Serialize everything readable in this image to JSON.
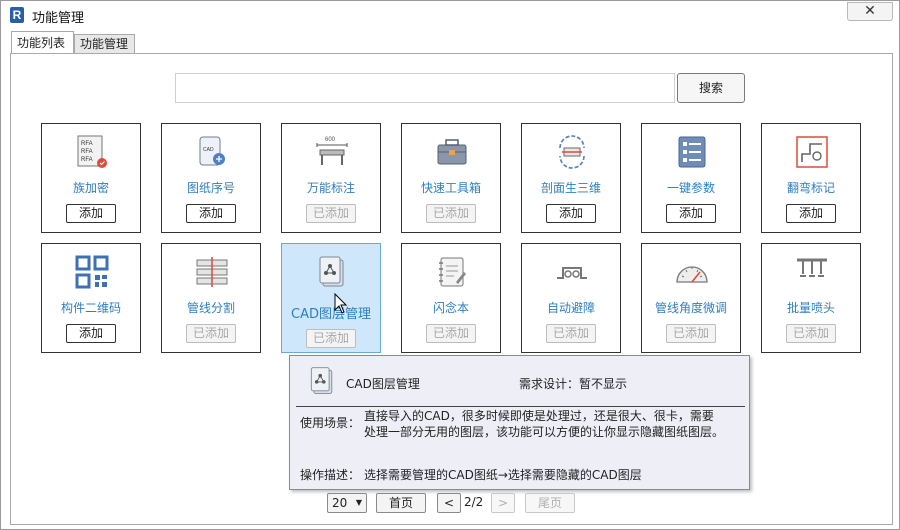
{
  "window": {
    "title": "功能管理",
    "close_symbol": "✕"
  },
  "tabs": [
    {
      "label": "功能列表",
      "active": true
    },
    {
      "label": "功能管理",
      "active": false
    }
  ],
  "search": {
    "value": "",
    "placeholder": "",
    "button_label": "搜索"
  },
  "cards": [
    {
      "label": "族加密",
      "button": "添加",
      "added": false,
      "icon": "rfa-lock-icon"
    },
    {
      "label": "图纸序号",
      "button": "添加",
      "added": false,
      "icon": "cad-sheet-number-icon"
    },
    {
      "label": "万能标注",
      "button": "已添加",
      "added": true,
      "icon": "dimension-icon"
    },
    {
      "label": "快速工具箱",
      "button": "已添加",
      "added": true,
      "icon": "toolbox-icon"
    },
    {
      "label": "剖面生三维",
      "button": "添加",
      "added": false,
      "icon": "section-3d-icon"
    },
    {
      "label": "一键参数",
      "button": "添加",
      "added": false,
      "icon": "parameter-list-icon"
    },
    {
      "label": "翻弯标记",
      "button": "添加",
      "added": false,
      "icon": "bend-mark-icon"
    },
    {
      "label": "构件二维码",
      "button": "添加",
      "added": false,
      "icon": "qr-code-icon"
    },
    {
      "label": "管线分割",
      "button": "已添加",
      "added": true,
      "icon": "pipe-split-icon"
    },
    {
      "label": "CAD图层管理",
      "button": "已添加",
      "added": true,
      "icon": "cad-layer-icon",
      "hover": true
    },
    {
      "label": "闪念本",
      "button": "已添加",
      "added": true,
      "icon": "notebook-icon"
    },
    {
      "label": "自动避障",
      "button": "已添加",
      "added": true,
      "icon": "auto-avoid-icon"
    },
    {
      "label": "管线角度微调",
      "button": "已添加",
      "added": true,
      "icon": "angle-gauge-icon"
    },
    {
      "label": "批量喷头",
      "button": "已添加",
      "added": true,
      "icon": "sprinkler-icon"
    }
  ],
  "tooltip": {
    "title": "CAD图层管理",
    "design": "需求设计：暂不显示",
    "scene_label": "使用场景：",
    "scene_text": "直接导入的CAD，很多时候即使是处理过，还是很大、很卡，需要处理一部分无用的图层，该功能可以方便的让你显示隐藏图纸图层。",
    "op_label": "操作描述：",
    "op_text": "选择需要管理的CAD图纸→选择需要隐藏的CAD图层"
  },
  "pager": {
    "page_size": "20",
    "first_label": "首页",
    "prev_label": "<",
    "info": "2/2",
    "next_label": ">",
    "last_label": "尾页"
  },
  "colors": {
    "accent": "#2d7fc2",
    "hover_bg": "#cfe7fb"
  }
}
